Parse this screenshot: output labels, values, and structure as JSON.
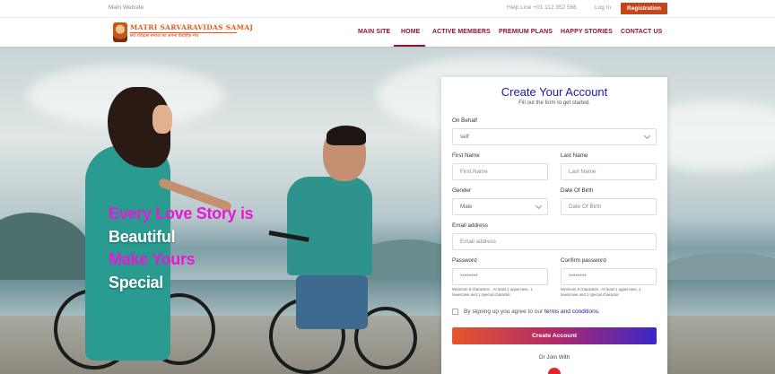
{
  "topbar": {
    "main_site": "Main Website",
    "helpline": "Help Line +01 112 352 566",
    "login": "Log In",
    "registration": "Registration"
  },
  "logo": {
    "title": "MATRI SARVARAVIDAS SAMAJ",
    "tagline": "सर्व रविदास समाज का अपना वैवाहिक मंच"
  },
  "nav": {
    "items": [
      "MAIN SITE",
      "HOME",
      "ACTIVE MEMBERS",
      "PREMIUM PLANS",
      "HAPPY STORIES",
      "CONTACT US"
    ],
    "active": "HOME"
  },
  "hero": {
    "line1": "Every Love Story is",
    "line2": "Beautiful",
    "line3": "Make Yours",
    "line4": "Special"
  },
  "form": {
    "title": "Create Your Account",
    "subtitle": "Fill out the form to get started.",
    "on_behalf_label": "On Behalf",
    "on_behalf_value": "self",
    "first_name_label": "First Name",
    "first_name_placeholder": "First Name",
    "last_name_label": "Last Name",
    "last_name_placeholder": "Last Name",
    "gender_label": "Gender",
    "gender_value": "Male",
    "dob_label": "Date Of Birth",
    "dob_placeholder": "Date Of Birth",
    "email_label": "Email address",
    "email_placeholder": "Email address",
    "password_label": "Password",
    "password_value": "********",
    "password_hint": "Minimum 8 characters , At least 1 uppercase, 1 lowercase and 1 special character",
    "confirm_label": "Confirm password",
    "confirm_value": "********",
    "confirm_hint": "Minimum 8 characters , At least 1 uppercase, 1 lowercase and 1 special character",
    "agree_text": "By signing up you agree to our",
    "terms_link": "terms and conditions.",
    "submit": "Create Account",
    "or_join": "Or Join With"
  },
  "colors": {
    "brand_maroon": "#8a1538",
    "registration_orange": "#c7441b",
    "title_blue": "#1a1aa3",
    "hero_pink": "#e619d4"
  }
}
